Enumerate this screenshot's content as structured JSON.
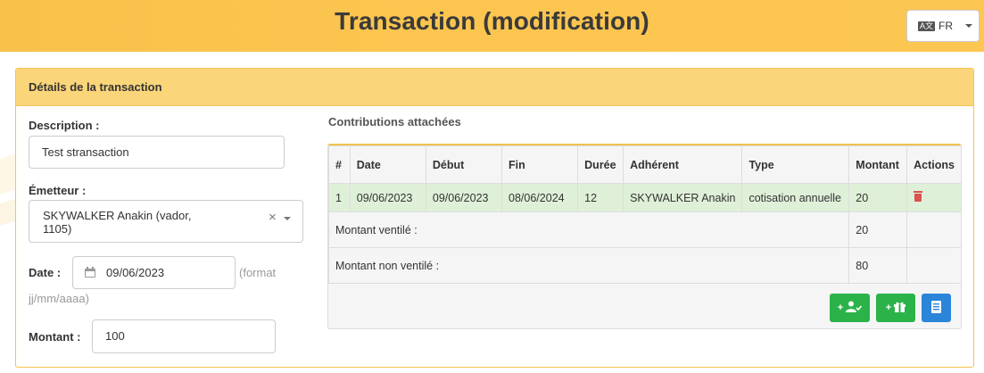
{
  "header": {
    "title": "Transaction (modification)",
    "language_flag": "Ä",
    "language": "FR"
  },
  "panel": {
    "title": "Détails de la transaction"
  },
  "form": {
    "description_label": "Description :",
    "description_value": "Test stransaction",
    "emitter_label": "Émetteur :",
    "emitter_value_line1": "SKYWALKER Anakin (vador,",
    "emitter_value_line2": "1105)",
    "emitter_clear": "×",
    "date_label": "Date :",
    "date_value": "09/06/2023",
    "date_hint_1": "(format",
    "date_hint_2": "jj/mm/aaaa)",
    "amount_label": "Montant :",
    "amount_value": "100"
  },
  "contributions": {
    "title": "Contributions attachées",
    "columns": [
      "#",
      "Date",
      "Début",
      "Fin",
      "Durée",
      "Adhérent",
      "Type",
      "Montant",
      "Actions"
    ],
    "rows": [
      {
        "num": "1",
        "date": "09/06/2023",
        "start": "09/06/2023",
        "end": "08/06/2024",
        "duration": "12",
        "member": "SKYWALKER Anakin",
        "type": "cotisation annuelle",
        "amount": "20"
      }
    ],
    "ventilated_label": "Montant ventilé :",
    "ventilated_value": "20",
    "non_ventilated_label": "Montant non ventilé :",
    "non_ventilated_value": "80",
    "buttons": {
      "add_member_label": "+",
      "add_gift_label": "+"
    }
  },
  "colors": {
    "header": "#fbc54f",
    "panel_head": "#fbd57a",
    "success": "#2bb34a",
    "primary": "#2b85d9",
    "danger": "#d9534f",
    "row_success": "#dff0d8"
  }
}
